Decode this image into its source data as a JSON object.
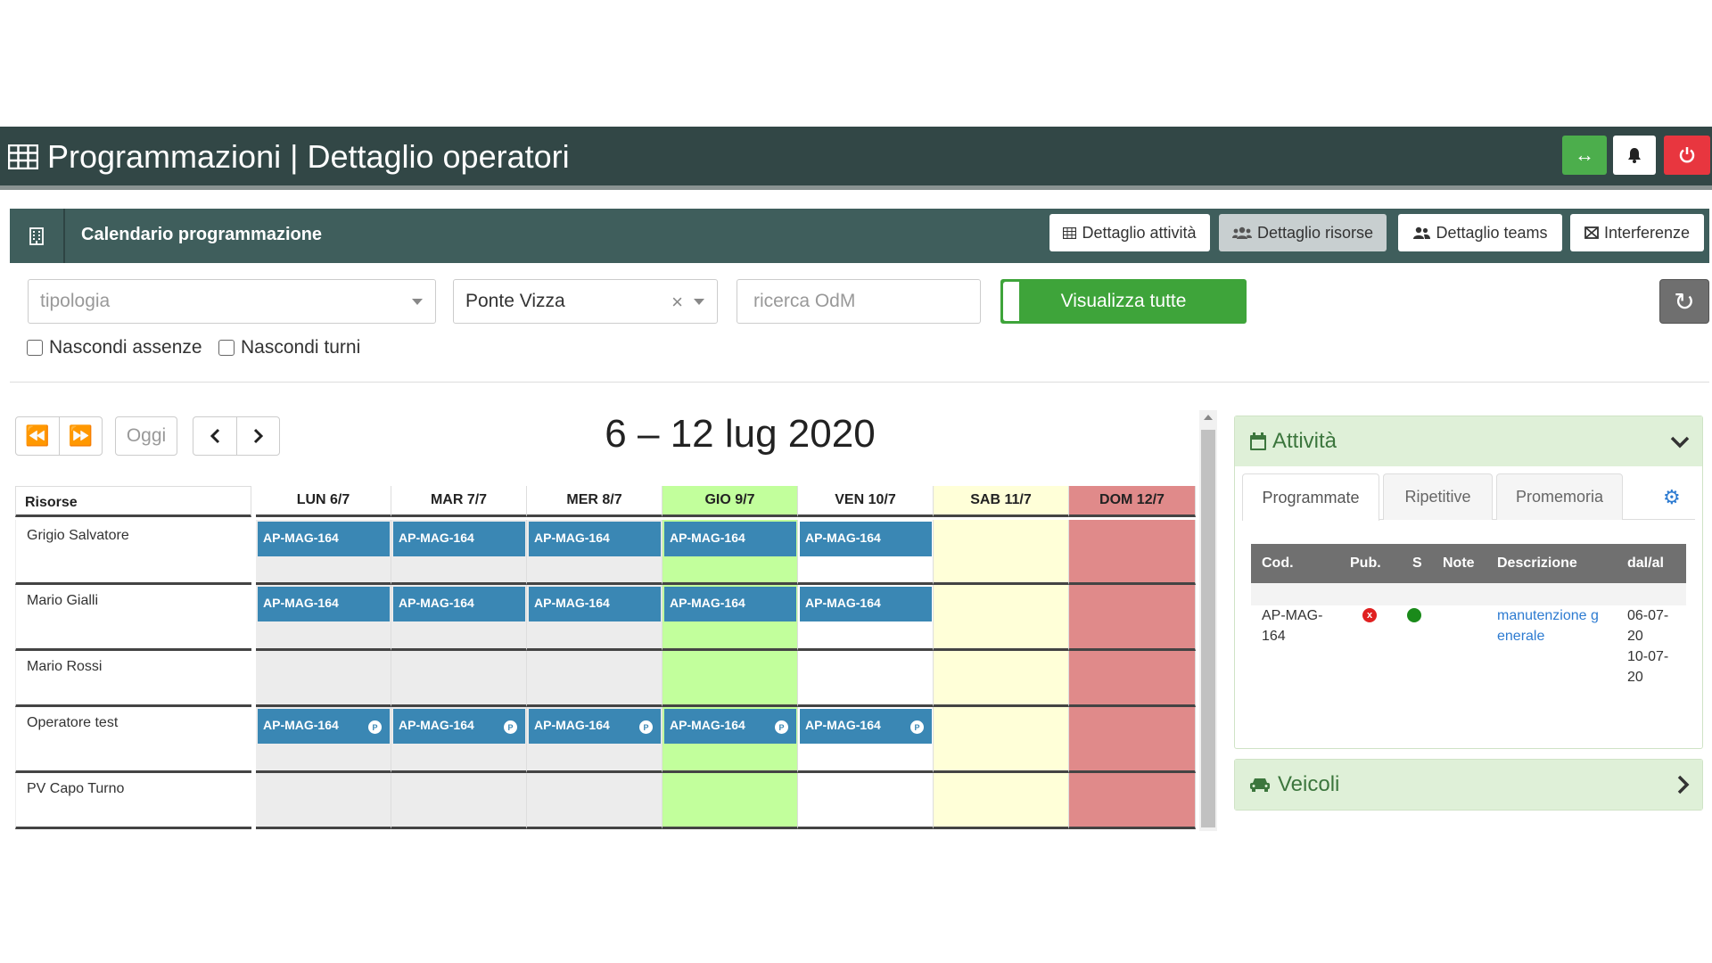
{
  "header": {
    "title": "Programmazioni | Dettaglio operatori",
    "buttons": {
      "expand_icon": "arrows-horizontal-icon",
      "bell_icon": "bell-icon",
      "power_icon": "power-icon"
    },
    "colors": {
      "bg": "#324746",
      "green": "#4cae4c",
      "red": "#e8363f"
    }
  },
  "section": {
    "title": "Calendario programmazione",
    "tabs": [
      {
        "label": "Dettaglio attività",
        "icon": "table-icon",
        "active": false
      },
      {
        "label": "Dettaglio risorse",
        "icon": "users-icon",
        "active": true
      },
      {
        "label": "Dettaglio teams",
        "icon": "user-group-icon",
        "active": false
      },
      {
        "label": "Interferenze",
        "icon": "interference-icon",
        "active": false
      }
    ]
  },
  "filters": {
    "tipologia_placeholder": "tipologia",
    "location_value": "Ponte Vizza",
    "search_placeholder": "ricerca OdM",
    "toggle_label": "Visualizza tutte",
    "checkbox_absences": "Nascondi assenze",
    "checkbox_shifts": "Nascondi turni"
  },
  "calendar": {
    "today_label": "Oggi",
    "range_title": "6 – 12 lug 2020",
    "resources_header": "Risorse",
    "days": [
      "LUN 6/7",
      "MAR 7/7",
      "MER 8/7",
      "GIO 9/7",
      "VEN 10/7",
      "SAB 11/7",
      "DOM 12/7"
    ],
    "resources": [
      "Grigio Salvatore",
      "Mario Gialli",
      "Mario Rossi",
      "Operatore test",
      "PV Capo Turno"
    ],
    "event_label": "AP-MAG-164",
    "event_badge": "P",
    "colors": {
      "event": "#3a87b4",
      "today": "#c2ff9c",
      "saturday": "#ffffd8",
      "sunday": "#e08a8a"
    }
  },
  "attivita_panel": {
    "title": "Attività",
    "tabs": [
      "Programmate",
      "Ripetitive",
      "Promemoria"
    ],
    "columns": [
      "Cod.",
      "Pub.",
      "S",
      "Note",
      "Descrizione",
      "dal/al"
    ],
    "row": {
      "code_line1": "AP-MAG-",
      "code_line2": "164",
      "pub_icon": "x",
      "desc_line1": "manutenzione g",
      "desc_line2": "enerale",
      "date_lines": [
        "06-07-",
        "20",
        "10-07-",
        "20"
      ]
    }
  },
  "veicoli_panel": {
    "title": "Veicoli"
  }
}
